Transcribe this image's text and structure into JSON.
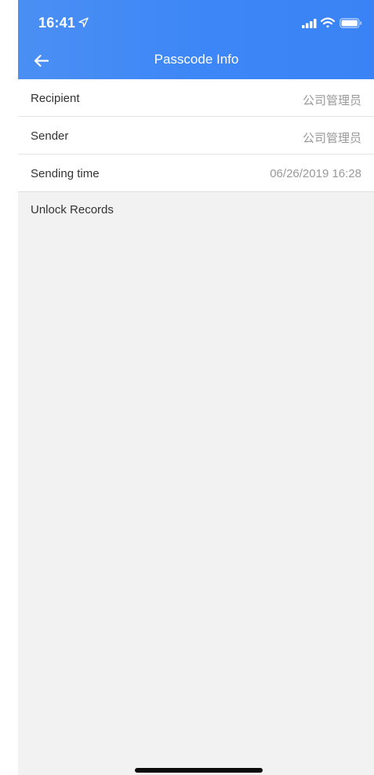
{
  "status_bar": {
    "time": "16:41",
    "location_icon": "location-arrow-icon",
    "signal_icon": "cellular-signal-icon",
    "wifi_icon": "wifi-icon",
    "battery_icon": "battery-icon"
  },
  "nav": {
    "back_icon": "arrow-left-icon",
    "title": "Passcode Info"
  },
  "info_rows": [
    {
      "label": "Recipient",
      "value": "公司管理员"
    },
    {
      "label": "Sender",
      "value": "公司管理员"
    },
    {
      "label": "Sending time",
      "value": "06/26/2019 16:28"
    }
  ],
  "unlock_records": {
    "title": "Unlock Records"
  },
  "colors": {
    "header": "#3c86f7",
    "background": "#f2f2f2",
    "label": "#333333",
    "value": "#999999"
  }
}
